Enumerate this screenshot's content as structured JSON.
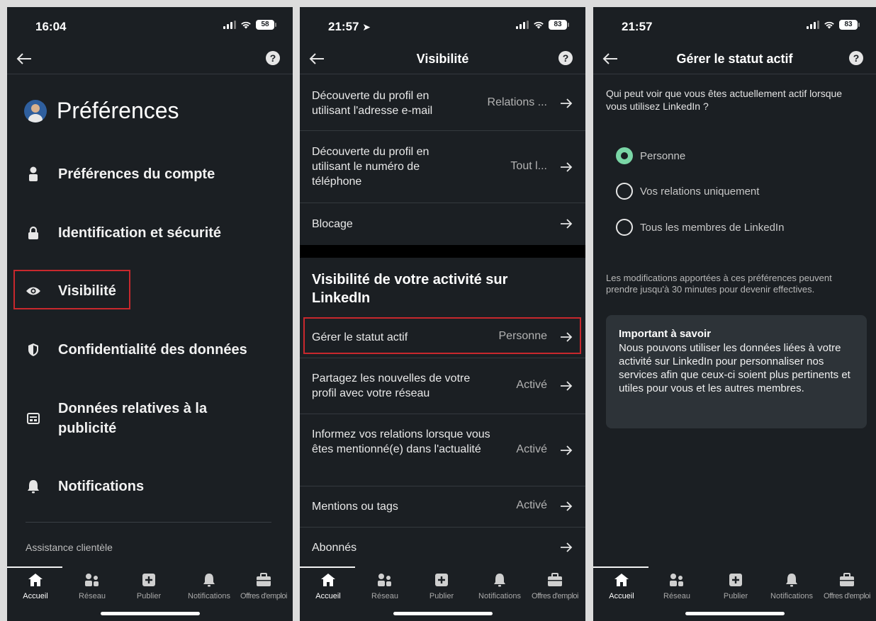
{
  "screens": [
    {
      "time": "16:04",
      "battery": "58",
      "title": "Préférences",
      "menu": [
        {
          "label": "Préférences du compte",
          "icon": "person-icon"
        },
        {
          "label": "Identification et sécurité",
          "icon": "lock-icon"
        },
        {
          "label": "Visibilité",
          "icon": "eye-icon"
        },
        {
          "label": "Confidentialité des données",
          "icon": "shield-icon"
        },
        {
          "label": "Données relatives à la publicité",
          "icon": "ad-card-icon"
        },
        {
          "label": "Notifications",
          "icon": "bell-icon"
        }
      ],
      "support_label": "Assistance clientèle"
    },
    {
      "time": "21:57",
      "battery": "83",
      "title": "Visibilité",
      "rows": [
        {
          "label": "Découverte du profil en utilisant l'adresse e-mail",
          "value": "Relations ..."
        },
        {
          "label": "Découverte du profil en utilisant le numéro de téléphone",
          "value": "Tout l..."
        },
        {
          "label": "Blocage",
          "value": ""
        }
      ],
      "section_title": "Visibilité de votre activité sur LinkedIn",
      "rows2": [
        {
          "label": "Gérer le statut actif",
          "value": "Personne"
        },
        {
          "label": "Partagez les nouvelles de votre profil avec votre réseau",
          "value": "Activé"
        },
        {
          "label": "Informez vos relations lorsque vous êtes mentionné(e) dans l'actualité",
          "value": "Activé"
        },
        {
          "label": "Mentions ou tags",
          "value": "Activé"
        },
        {
          "label": "Abonnés",
          "value": ""
        }
      ]
    },
    {
      "time": "21:57",
      "battery": "83",
      "title": "Gérer le statut actif",
      "question": "Qui peut voir que vous êtes actuellement actif lorsque vous utilisez LinkedIn ?",
      "options": [
        {
          "label": "Personne",
          "selected": true
        },
        {
          "label": "Vos relations uniquement",
          "selected": false
        },
        {
          "label": "Tous les membres de LinkedIn",
          "selected": false
        }
      ],
      "note": "Les modifications apportées à ces préférences peuvent prendre jusqu'à 30 minutes pour devenir effectives.",
      "card_title": "Important à savoir",
      "card_body": "Nous pouvons utiliser les données liées à votre activité sur LinkedIn pour personnaliser nos services afin que ceux-ci soient plus pertinents et utiles pour vous et les autres membres."
    }
  ],
  "tabs": [
    {
      "label": "Accueil",
      "icon": "home-icon"
    },
    {
      "label": "Réseau",
      "icon": "network-icon"
    },
    {
      "label": "Publier",
      "icon": "plus-square-icon"
    },
    {
      "label": "Notifications",
      "icon": "bell-icon"
    },
    {
      "label": "Offres d'emploi",
      "icon": "briefcase-icon"
    }
  ],
  "colors": {
    "background": "#1b1f23",
    "highlight": "#c8282d",
    "radio_selected": "#7ad6a6"
  }
}
